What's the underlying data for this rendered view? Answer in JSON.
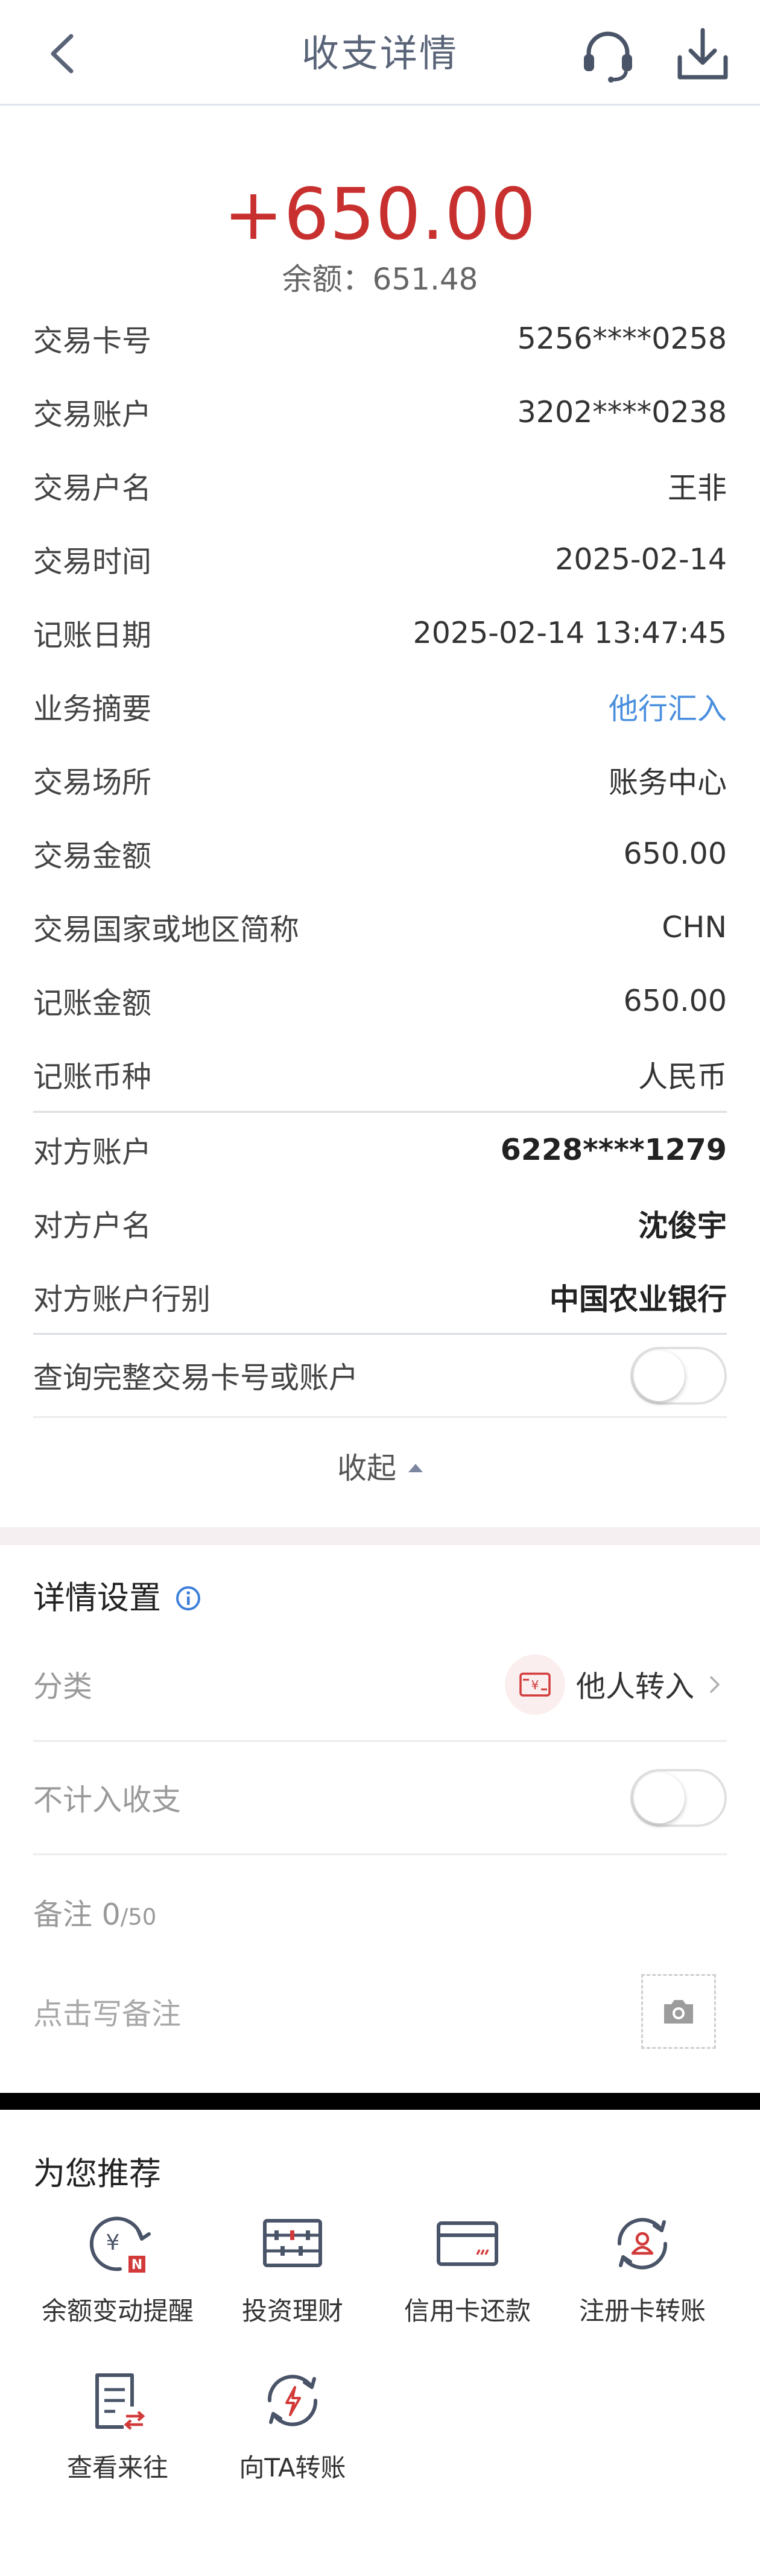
{
  "header": {
    "title": "收支详情",
    "back_icon": "chevron-left-icon",
    "service_icon": "headset-icon",
    "download_icon": "download-icon"
  },
  "summary": {
    "amount": "+650.00",
    "balance": "余额：651.48",
    "amount_color": "#c8302f"
  },
  "details": [
    {
      "key": "交易卡号",
      "value": "5256****0258"
    },
    {
      "key": "交易账户",
      "value": "3202****0238"
    },
    {
      "key": "交易户名",
      "value": "王非"
    },
    {
      "key": "交易时间",
      "value": "2025-02-14"
    },
    {
      "key": "记账日期",
      "value": "2025-02-14 13:47:45"
    },
    {
      "key": "业务摘要",
      "value": "他行汇入"
    },
    {
      "key": "交易场所",
      "value": "账务中心"
    },
    {
      "key": "交易金额",
      "value": "650.00"
    },
    {
      "key": "交易国家或地区简称",
      "value": "CHN"
    },
    {
      "key": "记账金额",
      "value": "650.00"
    },
    {
      "key": "记账币种",
      "value": "人民币"
    }
  ],
  "counterparty": [
    {
      "key": "对方账户",
      "value": "6228****1279"
    },
    {
      "key": "对方户名",
      "value": "沈俊宇"
    },
    {
      "key": "对方账户行别",
      "value": "中国农业银行"
    }
  ],
  "query_full_label": "查询完整交易卡号或账户",
  "query_full_on": false,
  "collapse_label": "收起",
  "detail_settings": {
    "title": "详情设置",
    "category_label": "分类",
    "category_value": "他人转入",
    "exclude_label": "不计入收支",
    "exclude_on": false,
    "note_label": "备注",
    "note_count": "0",
    "note_max": "/50",
    "note_placeholder": "点击写备注"
  },
  "recommend": {
    "title": "为您推荐",
    "items": [
      {
        "label": "余额变动提醒",
        "icon": "balance-alert-icon"
      },
      {
        "label": "投资理财",
        "icon": "abacus-icon"
      },
      {
        "label": "信用卡还款",
        "icon": "credit-card-icon"
      },
      {
        "label": "注册卡转账",
        "icon": "registered-transfer-icon"
      },
      {
        "label": "查看来往",
        "icon": "records-icon"
      },
      {
        "label": "向TA转账",
        "icon": "quick-transfer-icon"
      }
    ]
  },
  "colors": {
    "link": "#4a8fde",
    "icon_dark": "#4a5468",
    "accent_red": "#d23a3a"
  }
}
